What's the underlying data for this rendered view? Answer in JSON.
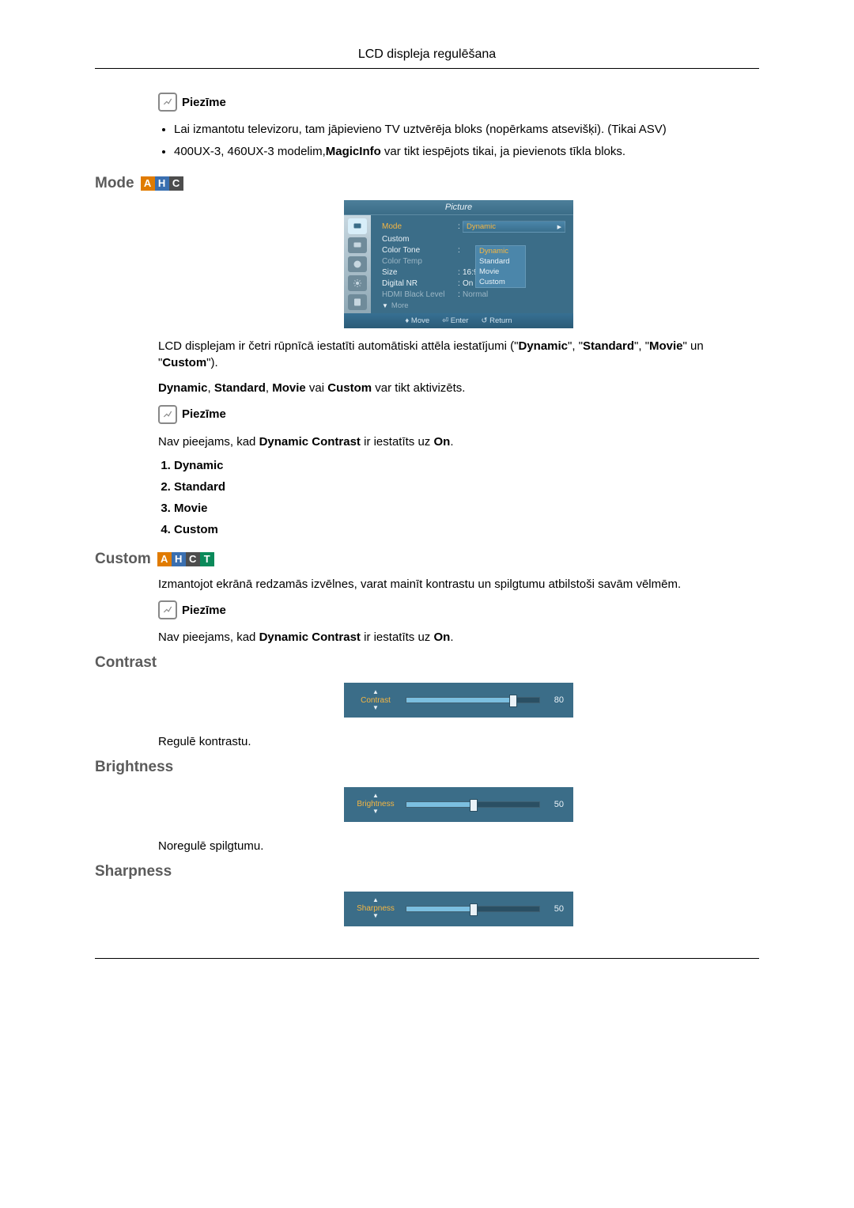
{
  "header": {
    "title": "LCD displeja regulēšana"
  },
  "note_label": "Piezīme",
  "note_top": {
    "bullet1": "Lai izmantotu televizoru, tam jāpievieno TV uztvērēja bloks (nopērkams atsevišķi). (Tikai ASV)",
    "bullet2_pre": "400UX-3, 460UX-3 modelim,",
    "bullet2_mid": "MagicInfo",
    "bullet2_post": " var tikt iespējots tikai, ja pievienots tīkla bloks."
  },
  "sections": {
    "mode": {
      "title": "Mode",
      "badges": [
        "A",
        "H",
        "C"
      ],
      "para1_pre": "LCD displejam ir četri rūpnīcā iestatīti automātiski attēla iestatījumi (\"",
      "para1_b1": "Dynamic",
      "para1_m1": "\", \"",
      "para1_b2": "Standard",
      "para1_m2": "\", \"",
      "para1_b3": "Movie",
      "para1_m3": "\" un \"",
      "para1_b4": "Custom",
      "para1_post": "\").",
      "para2_pre": "",
      "para2_b1": "Dynamic",
      "para2_m1": ", ",
      "para2_b2": "Standard",
      "para2_m2": ", ",
      "para2_b3": "Movie",
      "para2_m3": " vai ",
      "para2_b4": "Custom",
      "para2_post": " var tikt aktivizēts.",
      "note_body_pre": "Nav pieejams, kad ",
      "note_body_b": "Dynamic Contrast",
      "note_body_mid": " ir iestatīts uz ",
      "note_body_b2": "On",
      "note_body_post": ".",
      "list": [
        "Dynamic",
        "Standard",
        "Movie",
        "Custom"
      ]
    },
    "custom": {
      "title": "Custom",
      "badges": [
        "A",
        "H",
        "C",
        "T"
      ],
      "para": "Izmantojot ekrānā redzamās izvēlnes, varat mainīt kontrastu un spilgtumu atbilstoši savām vēlmēm.",
      "note_body_pre": "Nav pieejams, kad ",
      "note_body_b": "Dynamic Contrast",
      "note_body_mid": " ir iestatīts uz ",
      "note_body_b2": "On",
      "note_body_post": "."
    },
    "contrast": {
      "title": "Contrast",
      "desc": "Regulē kontrastu.",
      "slider": {
        "label": "Contrast",
        "value": 80
      }
    },
    "brightness": {
      "title": "Brightness",
      "desc": "Noregulē spilgtumu.",
      "slider": {
        "label": "Brightness",
        "value": 50
      }
    },
    "sharpness": {
      "title": "Sharpness",
      "slider": {
        "label": "Sharpness",
        "value": 50
      }
    }
  },
  "osd": {
    "title": "Picture",
    "rows": {
      "mode": {
        "label": "Mode",
        "value": "Dynamic",
        "options": [
          "Dynamic",
          "Standard",
          "Movie",
          "Custom"
        ]
      },
      "custom": {
        "label": "Custom"
      },
      "colortone": {
        "label": "Color Tone"
      },
      "colortemp": {
        "label": "Color Temp"
      },
      "size": {
        "label": "Size",
        "value": "16:9"
      },
      "digitalnr": {
        "label": "Digital NR",
        "value": "On"
      },
      "hdmiblack": {
        "label": "HDMI Black Level",
        "value": "Normal"
      }
    },
    "more": "More",
    "footer": {
      "move": "Move",
      "enter": "Enter",
      "return": "Return"
    }
  }
}
